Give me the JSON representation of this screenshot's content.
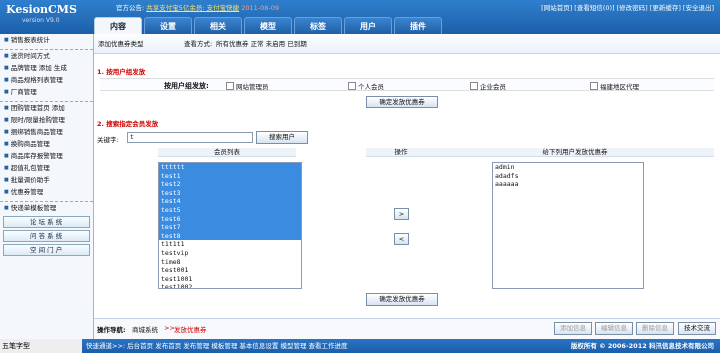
{
  "app": {
    "name": "KesionCMS",
    "version": "version V9.0"
  },
  "notice": {
    "label": "官方公告:",
    "link": "共享支付宝5亿余员: 支付宝快捷",
    "date": "2011-08-09"
  },
  "toplinks": "[网站首页] [查看短信(0)] [修改密码] [更新缓存] [安全退出]",
  "tabs": [
    "内容",
    "设置",
    "相关",
    "模型",
    "标签",
    "用户",
    "插件"
  ],
  "sidebar": {
    "items": [
      "销售报表统计",
      "—",
      "送货时间方式",
      "品牌管理 添加 生成",
      "商品规格列表管理",
      "厂商管理",
      "—",
      "团购管理首页 添加",
      "限时/限量抢购管理",
      "捆绑销售商品管理",
      "换购商品管理",
      "商品库存报警管理",
      "超值礼包管理",
      "批量调价助手",
      "优惠券管理",
      "—",
      "快递单模板管理"
    ],
    "buttons": [
      "论 坛 系 统",
      "问 答 系 统",
      "空 间 门 户"
    ]
  },
  "header": {
    "add_label": "添加优惠券类型",
    "view_label": "查看方式:",
    "view_options": "所有优惠券  正常  未启用  已到期"
  },
  "section1": {
    "title": "1. 按用户组发放",
    "group_label": "按用户组发放:",
    "groups": [
      "网站管理员",
      "个人会员",
      "企业会员",
      "福建地区代理"
    ],
    "button": "确定发放优惠券"
  },
  "section2": {
    "title": "2. 搜索指定会员发放",
    "keyword_label": "关键字:",
    "keyword_value": "t",
    "search_button": "搜索用户",
    "member_col": "会员列表",
    "op_col": "操作",
    "target_col": "给下列用户发放优惠券",
    "members": [
      {
        "name": "tttttt",
        "selected": true
      },
      {
        "name": "test1",
        "selected": true
      },
      {
        "name": "test2",
        "selected": true
      },
      {
        "name": "test3",
        "selected": true
      },
      {
        "name": "test4",
        "selected": true
      },
      {
        "name": "test5",
        "selected": true
      },
      {
        "name": "test6",
        "selected": true
      },
      {
        "name": "test7",
        "selected": true
      },
      {
        "name": "test8",
        "selected": true
      },
      {
        "name": "t1t1t1",
        "selected": false
      },
      {
        "name": "testvip",
        "selected": false
      },
      {
        "name": "time8",
        "selected": false
      },
      {
        "name": "test001",
        "selected": false
      },
      {
        "name": "test1001",
        "selected": false
      },
      {
        "name": "test1002",
        "selected": false
      }
    ],
    "targets": [
      "admin",
      "adadfs",
      "aaaaaa"
    ],
    "add_arrow": ">",
    "remove_arrow": "<",
    "button": "确定发放优惠券"
  },
  "bottombar": {
    "nav_label": "操作导航:",
    "nav_path": "商城系统",
    "nav_sep": ">>",
    "nav_current": "发放优惠券",
    "buttons": [
      "添加信息",
      "编辑信息",
      "删除信息",
      "技术交流"
    ]
  },
  "footer": {
    "taskbar": "五笔字型",
    "links": "快速通道>>:  后台首页  发布首页  发布管理  模板管理  基本信息设置  模型管理  查看工作进度",
    "copyright": "版权所有 © 2006-2012 科汛信息技术有限公司"
  }
}
